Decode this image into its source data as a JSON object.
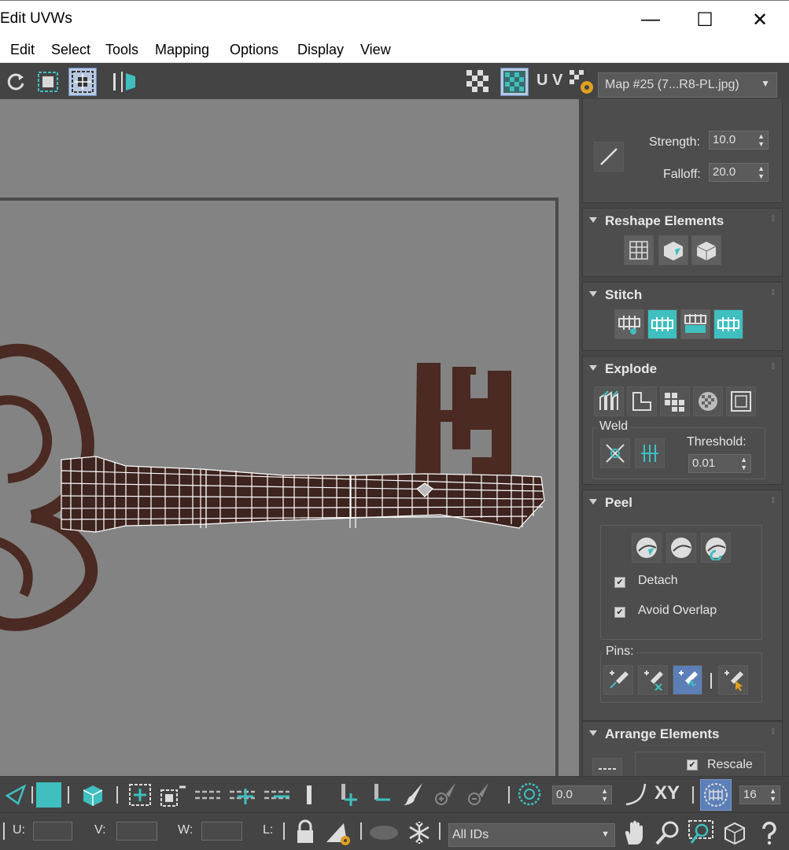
{
  "window": {
    "title": "Edit UVWs",
    "controls": {
      "minimize": "—",
      "maximize": "☐",
      "close": "✕"
    }
  },
  "menu": [
    "Edit",
    "Select",
    "Tools",
    "Mapping",
    "Options",
    "Display",
    "View"
  ],
  "toolbar": {
    "uv_label": "U V",
    "map_select": "Map #25 (7...R8-PL.jpg)"
  },
  "panel": {
    "brush": {
      "strength_label": "Strength:",
      "strength_value": "10.0",
      "falloff_label": "Falloff:",
      "falloff_value": "20.0"
    },
    "reshape_elements": {
      "title": "Reshape Elements"
    },
    "stitch": {
      "title": "Stitch"
    },
    "explode": {
      "title": "Explode",
      "weld_label": "Weld",
      "threshold_label": "Threshold:",
      "threshold_value": "0.01"
    },
    "peel": {
      "title": "Peel",
      "detach_label": "Detach",
      "detach_checked": true,
      "avoid_overlap_label": "Avoid Overlap",
      "avoid_overlap_checked": true,
      "pins_label": "Pins:"
    },
    "arrange_elements": {
      "title": "Arrange Elements",
      "rescale_label": "Rescale",
      "rescale_checked": true
    }
  },
  "bottom": {
    "angle_value": "0.0",
    "xy_label": "XY",
    "grid_value": "16",
    "u_label": "U:",
    "v_label": "V:",
    "w_label": "W:",
    "l_label": "L:",
    "ids_select": "All IDs"
  },
  "colors": {
    "accent_cyan": "#3fbfbf",
    "viewport_bg": "#838383",
    "panel_bg": "#464646",
    "key_rust": "#4a2a22"
  }
}
